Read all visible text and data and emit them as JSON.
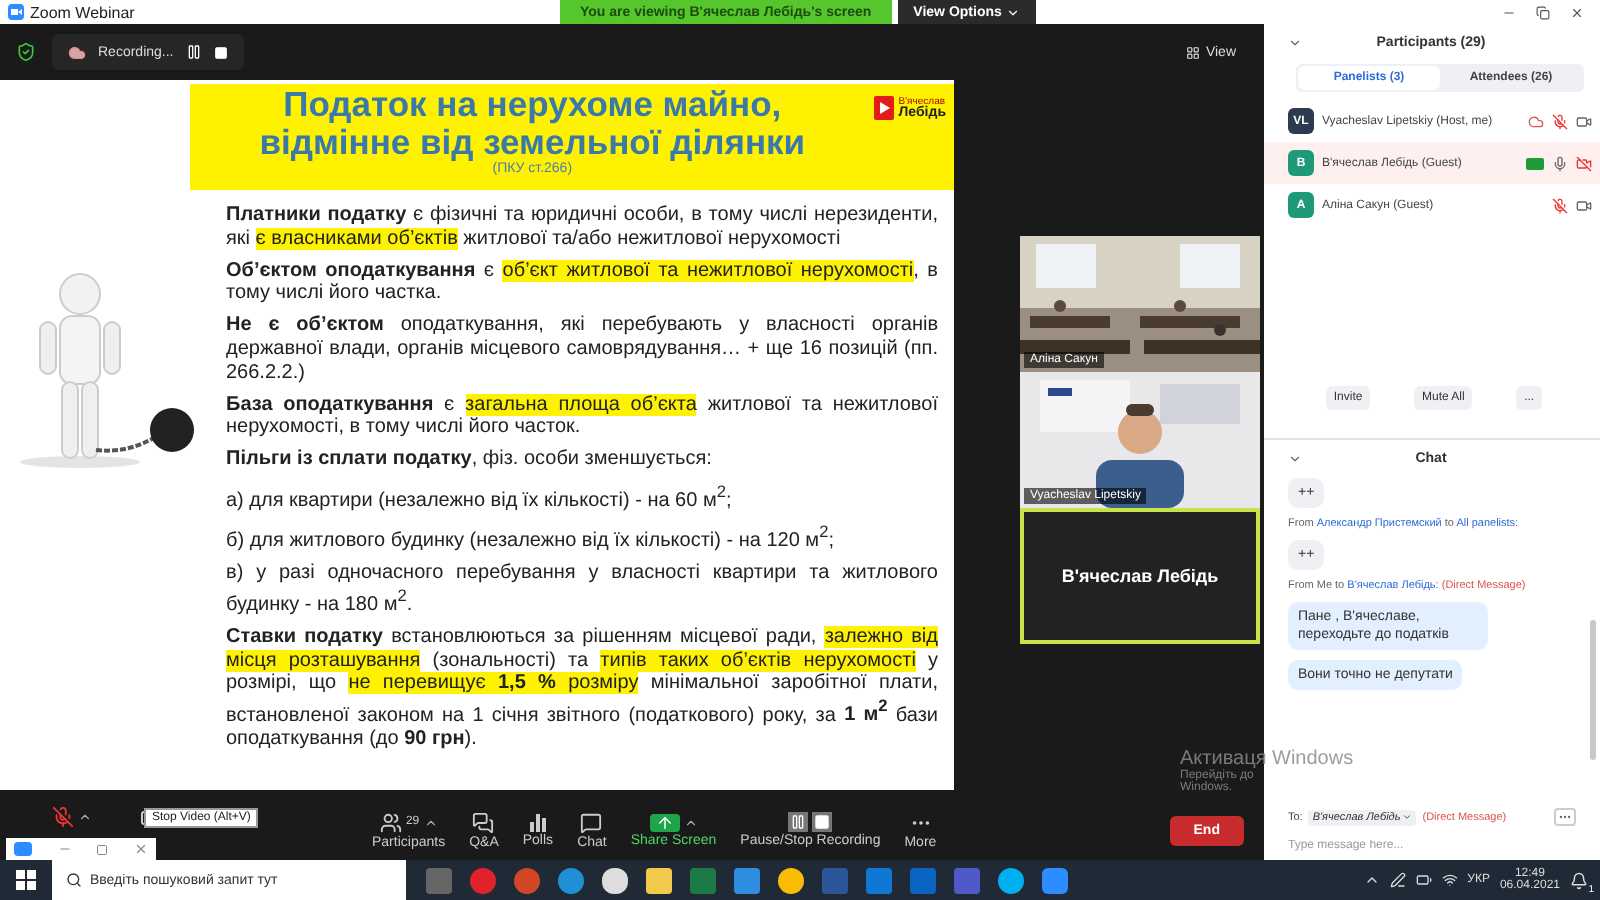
{
  "title_bar": {
    "title": "Zoom Webinar",
    "banner": "You are viewing В'ячеслав Лебідь's screen",
    "view_options": "View Options"
  },
  "meeting": {
    "recording": "Recording...",
    "view_button": "View"
  },
  "slide": {
    "title_lines": [
      "Податок на нерухоме майно,",
      "відмінне від земельної ділянки"
    ],
    "subtitle": "(ПКУ ст.266)",
    "logo": [
      "В'ячеслав",
      "Лебідь"
    ],
    "paragraphs": [
      [
        {
          "text": "Платники податку",
          "bold": true,
          "highlight": false
        },
        {
          "text": " є фізичні та юридичні особи, в тому числі нерезиденти, які ",
          "bold": false,
          "highlight": false
        },
        {
          "text": "є власниками об’єктів",
          "bold": false,
          "highlight": true
        },
        {
          "text": " житлової та/або нежитлової нерухомості",
          "bold": false,
          "highlight": false
        }
      ],
      [
        {
          "text": "Об’єктом оподаткування",
          "bold": true,
          "highlight": false
        },
        {
          "text": " є ",
          "bold": false,
          "highlight": false
        },
        {
          "text": "об’єкт житлової та нежитлової нерухомості",
          "bold": false,
          "highlight": true
        },
        {
          "text": ", в тому числі його частка.",
          "bold": false,
          "highlight": false
        }
      ],
      [
        {
          "text": "Не є об’єктом",
          "bold": true,
          "highlight": false
        },
        {
          "text": " оподаткування, які перебувають у власності органів державної влади, органів місцевого самоврядування… + ще 16 позицій (пп. 266.2.2.)",
          "bold": false,
          "highlight": false
        }
      ],
      [
        {
          "text": "База оподаткування",
          "bold": true,
          "highlight": false
        },
        {
          "text": " є ",
          "bold": false,
          "highlight": false
        },
        {
          "text": "загальна площа об’єкта",
          "bold": false,
          "highlight": true
        },
        {
          "text": " житлової та нежитлової нерухомості, в тому числі його часток.",
          "bold": false,
          "highlight": false
        }
      ],
      [
        {
          "text": "Пільги із сплати податку",
          "bold": true,
          "highlight": false
        },
        {
          "text": ", фіз. особи зменшується:",
          "bold": false,
          "highlight": false
        }
      ],
      [
        {
          "text": "а) для квартири (незалежно від їх кількості) - на 60 м$^{2}$;",
          "bold": false,
          "highlight": false
        }
      ],
      [
        {
          "text": "б) для житлового будинку (незалежно від їх кількості) - на 120 м$^{2}$;",
          "bold": false,
          "highlight": false
        }
      ],
      [
        {
          "text": "в) у разі одночасного перебування у власності квартири та житлового будинку - на 180 м$^{2}$.",
          "bold": false,
          "highlight": false
        }
      ],
      [
        {
          "text": "Ставки податку",
          "bold": true,
          "highlight": false
        },
        {
          "text": " встановлюються за рішенням місцевої ради, ",
          "bold": false,
          "highlight": false
        },
        {
          "text": "залежно від місця розташування",
          "bold": false,
          "highlight": true
        },
        {
          "text": " (зональності) та ",
          "bold": false,
          "highlight": false
        },
        {
          "text": "типів таких об’єктів нерухомості",
          "bold": false,
          "highlight": true
        },
        {
          "text": " у розмірі, що ",
          "bold": false,
          "highlight": false
        },
        {
          "text": "не перевищує **1,5 %** розміру",
          "bold": false,
          "highlight": true
        },
        {
          "text": " мінімальної заробітної плати, встановленої законом на 1 січня звітного (податкового) року, за **1 м$^{2}$** бази оподаткування (до **90 грн**).",
          "bold": false,
          "highlight": false
        }
      ]
    ]
  },
  "video_tiles": [
    {
      "kind": "video",
      "name": "Аліна Сакун",
      "active_speaker": false
    },
    {
      "kind": "video",
      "name": "Vyacheslav Lipetskiy",
      "active_speaker": false
    },
    {
      "kind": "name_only",
      "name": "В'ячеслав Лебідь",
      "active_speaker": true
    }
  ],
  "toolbar": {
    "items": [
      {
        "kind": "mic",
        "muted": true
      },
      {
        "kind": "video"
      },
      {
        "kind": "participants",
        "label": "Participants",
        "count": "29"
      },
      {
        "kind": "qa",
        "label": "Q&A"
      },
      {
        "kind": "polls",
        "label": "Polls"
      },
      {
        "kind": "chat",
        "label": "Chat"
      },
      {
        "kind": "share",
        "label": "Share Screen"
      },
      {
        "kind": "recording",
        "label": "Pause/Stop Recording"
      },
      {
        "kind": "more",
        "label": "More"
      }
    ],
    "end_button": "End",
    "tooltip": "Stop Video (Alt+V)"
  },
  "windows_activation": [
    "Активаця Windows",
    "Перейдіть до",
    "Windows."
  ],
  "participants_panel": {
    "title": "Participants (29)",
    "tabs": [
      {
        "label": "Panelists (3)",
        "selected": true
      },
      {
        "label": "Attendees (26)",
        "selected": false
      }
    ],
    "rows": [
      {
        "initials": "VL",
        "name": "Vyacheslav Lipetskiy (Host, me)",
        "color": "#2c3a50",
        "highlighted": false,
        "recording": true,
        "sharing": false,
        "muted": true,
        "video_off": false
      },
      {
        "initials": "В",
        "name": "В'ячеслав Лебідь (Guest)",
        "color": "#1e9a78",
        "highlighted": true,
        "recording": false,
        "sharing": true,
        "muted": false,
        "video_off": true
      },
      {
        "initials": "А",
        "name": "Аліна Сакун (Guest)",
        "color": "#1e9a78",
        "highlighted": false,
        "recording": false,
        "sharing": false,
        "muted": true,
        "video_off": false
      }
    ],
    "buttons": [
      "Invite",
      "Mute All",
      "..."
    ]
  },
  "chat": {
    "title": "Chat",
    "messages": [
      {
        "kind": "bubble",
        "own": false,
        "text": "++"
      },
      {
        "kind": "meta",
        "prefix": "From ",
        "sender": "Александр Пристемский",
        "middle": " to ",
        "recipient": "All panelists:"
      },
      {
        "kind": "bubble",
        "own": false,
        "text": "++"
      },
      {
        "kind": "meta",
        "prefix": "From Me to ",
        "recipient": "В'ячеслав Лебідь:",
        "note": " (Direct Message)"
      },
      {
        "kind": "bubble",
        "own": true,
        "text": "Пане , В'ячеславе, переходьте до податків"
      },
      {
        "kind": "bubble",
        "own": true,
        "text": "Вони точно не депутати"
      }
    ],
    "to_label": "To:",
    "recipient": "В'ячеслав Лебідь",
    "direct": "(Direct Message)",
    "placeholder": "Type message here..."
  },
  "taskbar": {
    "search_placeholder": "Введіть пошуковий запит тут",
    "language": "УКР",
    "time": "12:49",
    "date": "06.04.2021",
    "notifications": "1"
  }
}
